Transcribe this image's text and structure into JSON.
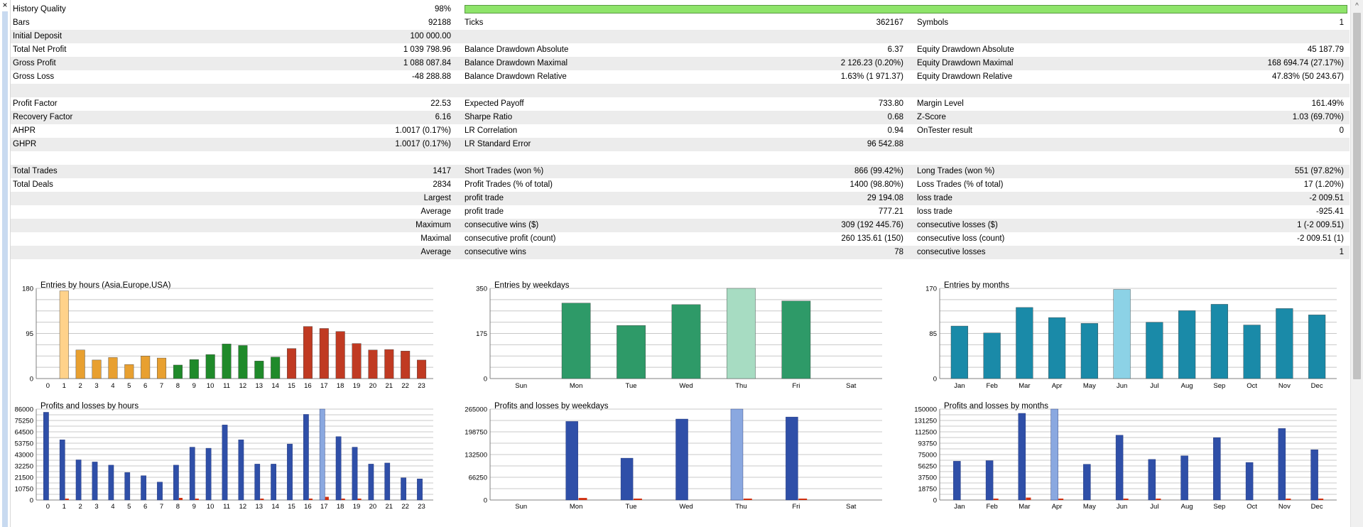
{
  "window": {
    "close_glyph": "×",
    "scroll_up_glyph": "^"
  },
  "colors": {
    "quality_bar": "#8ee46a",
    "row_alt": "#ececec",
    "grid": "#c8c8c8",
    "profit_bar": "#2f4fa8",
    "loss_bar": "#d03010"
  },
  "history_quality": {
    "label": "History Quality",
    "value": "98%",
    "fraction": 0.98
  },
  "rows": [
    {
      "alt": false,
      "cells": [
        "Bars",
        "92188",
        "Ticks",
        "362167",
        "Symbols",
        "1"
      ]
    },
    {
      "alt": true,
      "cells": [
        "Initial Deposit",
        "100 000.00",
        "",
        "",
        "",
        ""
      ]
    },
    {
      "alt": false,
      "cells": [
        "Total Net Profit",
        "1 039 798.96",
        "Balance Drawdown Absolute",
        "6.37",
        "Equity Drawdown Absolute",
        "45 187.79"
      ]
    },
    {
      "alt": true,
      "cells": [
        "Gross Profit",
        "1 088 087.84",
        "Balance Drawdown Maximal",
        "2 126.23 (0.20%)",
        "Equity Drawdown Maximal",
        "168 694.74 (27.17%)"
      ]
    },
    {
      "alt": false,
      "cells": [
        "Gross Loss",
        "-48 288.88",
        "Balance Drawdown Relative",
        "1.63% (1 971.37)",
        "Equity Drawdown Relative",
        "47.83% (50 243.67)"
      ]
    },
    {
      "alt": true,
      "cells": [
        "",
        "",
        "",
        "",
        "",
        ""
      ]
    },
    {
      "alt": false,
      "cells": [
        "Profit Factor",
        "22.53",
        "Expected Payoff",
        "733.80",
        "Margin Level",
        "161.49%"
      ]
    },
    {
      "alt": true,
      "cells": [
        "Recovery Factor",
        "6.16",
        "Sharpe Ratio",
        "0.68",
        "Z-Score",
        "1.03 (69.70%)"
      ]
    },
    {
      "alt": false,
      "cells": [
        "AHPR",
        "1.0017 (0.17%)",
        "LR Correlation",
        "0.94",
        "OnTester result",
        "0"
      ]
    },
    {
      "alt": true,
      "cells": [
        "GHPR",
        "1.0017 (0.17%)",
        "LR Standard Error",
        "96 542.88",
        "",
        ""
      ]
    },
    {
      "alt": false,
      "cells": [
        "",
        "",
        "",
        "",
        "",
        ""
      ]
    },
    {
      "alt": true,
      "cells": [
        "Total Trades",
        "1417",
        "Short Trades (won %)",
        "866 (99.42%)",
        "Long Trades (won %)",
        "551 (97.82%)"
      ]
    },
    {
      "alt": false,
      "cells": [
        "Total Deals",
        "2834",
        "Profit Trades (% of total)",
        "1400 (98.80%)",
        "Loss Trades (% of total)",
        "17 (1.20%)"
      ]
    },
    {
      "alt": true,
      "cells": [
        "",
        "Largest",
        "profit trade",
        "29 194.08",
        "loss trade",
        "-2 009.51"
      ]
    },
    {
      "alt": false,
      "cells": [
        "",
        "Average",
        "profit trade",
        "777.21",
        "loss trade",
        "-925.41"
      ]
    },
    {
      "alt": true,
      "cells": [
        "",
        "Maximum",
        "consecutive wins ($)",
        "309 (192 445.76)",
        "consecutive losses ($)",
        "1 (-2 009.51)"
      ]
    },
    {
      "alt": false,
      "cells": [
        "",
        "Maximal",
        "consecutive profit (count)",
        "260 135.61 (150)",
        "consecutive loss (count)",
        "-2 009.51 (1)"
      ]
    },
    {
      "alt": true,
      "cells": [
        "",
        "Average",
        "consecutive wins",
        "78",
        "consecutive losses",
        "1"
      ]
    },
    {
      "alt": false,
      "cells": [
        "",
        "",
        "",
        "",
        "",
        ""
      ]
    }
  ],
  "chart_data": [
    {
      "type": "bar",
      "title": "Entries by hours (Asia,Europe,USA)",
      "yticks": [
        "180",
        "95",
        "0"
      ],
      "ylim": [
        0,
        180
      ],
      "categories": [
        "0",
        "1",
        "2",
        "3",
        "4",
        "5",
        "6",
        "7",
        "8",
        "9",
        "10",
        "11",
        "12",
        "13",
        "14",
        "15",
        "16",
        "17",
        "18",
        "19",
        "20",
        "21",
        "22",
        "23"
      ],
      "values": [
        0,
        175,
        57,
        37,
        42,
        28,
        45,
        41,
        27,
        38,
        48,
        69,
        66,
        35,
        43,
        60,
        104,
        100,
        94,
        70,
        57,
        58,
        55,
        37
      ],
      "bar_colors": [
        "#e8a030",
        "#e8a030",
        "#e8a030",
        "#e8a030",
        "#e8a030",
        "#e8a030",
        "#e8a030",
        "#e8a030",
        "#1f8a2a",
        "#1f8a2a",
        "#1f8a2a",
        "#1f8a2a",
        "#1f8a2a",
        "#1f8a2a",
        "#1f8a2a",
        "#c03a22",
        "#c03a22",
        "#c03a22",
        "#c03a22",
        "#c03a22",
        "#c03a22",
        "#c03a22",
        "#c03a22",
        "#c03a22"
      ],
      "highlight": 1
    },
    {
      "type": "bar",
      "title": "Entries by weekdays",
      "yticks": [
        "350",
        "175",
        "0"
      ],
      "ylim": [
        0,
        350
      ],
      "categories": [
        "Sun",
        "Mon",
        "Tue",
        "Wed",
        "Thu",
        "Fri",
        "Sat"
      ],
      "values": [
        0,
        293,
        206,
        287,
        350,
        301,
        0
      ],
      "bar_colors": [
        "#2e9a68",
        "#2e9a68",
        "#2e9a68",
        "#2e9a68",
        "#2e9a68",
        "#2e9a68",
        "#2e9a68"
      ],
      "highlight": 4
    },
    {
      "type": "bar",
      "title": "Entries by months",
      "yticks": [
        "170",
        "85",
        "0"
      ],
      "ylim": [
        0,
        170
      ],
      "categories": [
        "Jan",
        "Feb",
        "Mar",
        "Apr",
        "May",
        "Jun",
        "Jul",
        "Aug",
        "Sep",
        "Oct",
        "Nov",
        "Dec"
      ],
      "values": [
        99,
        86,
        134,
        115,
        104,
        168,
        106,
        128,
        140,
        101,
        132,
        120
      ],
      "bar_colors": [
        "#1a8aa8",
        "#1a8aa8",
        "#1a8aa8",
        "#1a8aa8",
        "#1a8aa8",
        "#1a8aa8",
        "#1a8aa8",
        "#1a8aa8",
        "#1a8aa8",
        "#1a8aa8",
        "#1a8aa8",
        "#1a8aa8"
      ],
      "highlight": 5
    },
    {
      "type": "bar",
      "title": "Profits and losses by hours",
      "yticks": [
        "86000",
        "75250",
        "64500",
        "53750",
        "43000",
        "32250",
        "21500",
        "10750",
        "0"
      ],
      "ylim": [
        0,
        86000
      ],
      "categories": [
        "0",
        "1",
        "2",
        "3",
        "4",
        "5",
        "6",
        "7",
        "8",
        "9",
        "10",
        "11",
        "12",
        "13",
        "14",
        "15",
        "16",
        "17",
        "18",
        "19",
        "20",
        "21",
        "22",
        "23"
      ],
      "series": [
        {
          "values": [
            83000,
            57000,
            38000,
            36000,
            33000,
            26000,
            23000,
            17000,
            33000,
            50000,
            49000,
            71000,
            57000,
            34000,
            34000,
            53000,
            81000,
            86000,
            60000,
            50000,
            34000,
            35000,
            21000,
            20000
          ]
        },
        {
          "values": [
            0,
            1000,
            0,
            0,
            0,
            0,
            0,
            0,
            2000,
            1000,
            0,
            0,
            0,
            1000,
            0,
            0,
            1000,
            3000,
            1000,
            1000,
            0,
            0,
            0,
            0
          ]
        }
      ],
      "highlight": 17
    },
    {
      "type": "bar",
      "title": "Profits and losses by weekdays",
      "yticks": [
        "265000",
        "198750",
        "132500",
        "66250",
        "0"
      ],
      "ylim": [
        0,
        265000
      ],
      "categories": [
        "Sun",
        "Mon",
        "Tue",
        "Wed",
        "Thu",
        "Fri",
        "Sat"
      ],
      "series": [
        {
          "values": [
            0,
            229000,
            122000,
            236000,
            265000,
            242000,
            0
          ]
        },
        {
          "values": [
            0,
            6000,
            4000,
            0,
            4000,
            2000,
            0
          ]
        }
      ],
      "highlight": 4
    },
    {
      "type": "bar",
      "title": "Profits and losses by months",
      "yticks": [
        "150000",
        "131250",
        "112500",
        "93750",
        "75000",
        "56250",
        "37500",
        "18750",
        "0"
      ],
      "ylim": [
        0,
        150000
      ],
      "categories": [
        "Jan",
        "Feb",
        "Mar",
        "Apr",
        "May",
        "Jun",
        "Jul",
        "Aug",
        "Sep",
        "Oct",
        "Nov",
        "Dec"
      ],
      "series": [
        {
          "values": [
            64000,
            65000,
            143000,
            150000,
            59000,
            107000,
            67000,
            73000,
            103000,
            62000,
            118000,
            83000
          ]
        },
        {
          "values": [
            0,
            2000,
            4000,
            2000,
            0,
            2000,
            1000,
            0,
            0,
            0,
            1000,
            2000
          ]
        }
      ],
      "highlight": 3
    }
  ]
}
